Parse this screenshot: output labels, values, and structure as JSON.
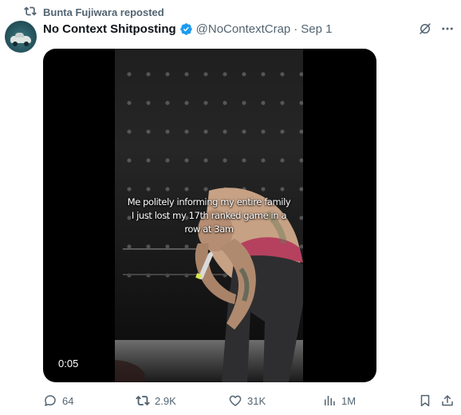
{
  "repost_label": "Bunta Fujiwara reposted",
  "tweet": {
    "display_name": "No Context Shitposting",
    "handle": "@NoContextCrap",
    "separator": "·",
    "date": "Sep 1",
    "verified": true
  },
  "media": {
    "caption_lines": [
      "Me politely informing my entire family",
      "I just lost my 17th ranked game in a",
      "row at 3am"
    ],
    "timestamp": "0:05"
  },
  "actions": {
    "replies": "64",
    "reposts": "2.9K",
    "likes": "31K",
    "views": "1M"
  },
  "colors": {
    "text_primary": "#0f1419",
    "text_secondary": "#536471",
    "verified_badge": "#1d9bf0"
  },
  "icons": [
    "repost-icon",
    "verified-badge-icon",
    "grok-icon",
    "more-icon",
    "reply-icon",
    "repost-icon",
    "like-icon",
    "views-icon",
    "bookmark-icon",
    "share-icon"
  ]
}
